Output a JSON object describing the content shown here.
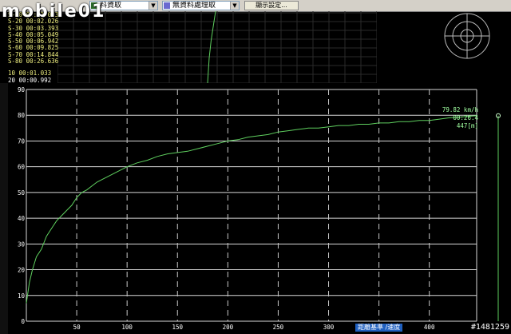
{
  "toolbar": {
    "select1_value": "料資取",
    "select2_value": "無資料處理取",
    "button_label": "顯示設定..."
  },
  "logo": "mobile01",
  "splits": [
    "S-10 00:01.033",
    "S-20 00:02.026",
    "S-30 00:03.393",
    "S-40 00:05.049",
    "S-50 00:06.942",
    "S-60 00:09.825",
    "S-70 00:14.844",
    "S-80 00:26.636"
  ],
  "splits_extra": [
    "10  00:01.033",
    "20  00:00.992"
  ],
  "readout": {
    "speed": "79.82 km/h",
    "time": "00:26.4",
    "distance": "447[m]"
  },
  "footer_label": "距離基準 /速度",
  "watermark": "#1481259",
  "colors": {
    "background": "#000000",
    "line": "#5fd05f",
    "grid": "#ffffff"
  },
  "chart_data": {
    "type": "line",
    "title": "",
    "xlabel": "",
    "ylabel": "",
    "xlim": [
      0,
      447
    ],
    "ylim": [
      0,
      90
    ],
    "xticks": [
      50,
      100,
      150,
      200,
      250,
      300,
      350,
      400
    ],
    "yticks": [
      0,
      10,
      20,
      30,
      40,
      50,
      60,
      70,
      80,
      90
    ],
    "grid": true,
    "series": [
      {
        "x": [
          0,
          3,
          6,
          10,
          15,
          20,
          25,
          30,
          35,
          40,
          45,
          50,
          55,
          60,
          70,
          80,
          90,
          100,
          110,
          120,
          130,
          140,
          150,
          160,
          170,
          180,
          190,
          200,
          210,
          220,
          230,
          240,
          250,
          260,
          270,
          280,
          290,
          300,
          310,
          320,
          330,
          340,
          350,
          360,
          370,
          380,
          390,
          400,
          410,
          420,
          430,
          440,
          447
        ],
        "y": [
          7,
          15,
          20,
          25,
          28,
          33,
          36,
          39,
          41,
          43,
          45,
          48,
          50,
          51,
          54,
          56,
          58,
          60,
          61.5,
          62.5,
          64,
          65,
          65.5,
          66,
          67,
          68,
          69,
          70,
          70.5,
          71.5,
          72,
          72.5,
          73.5,
          74,
          74.5,
          75,
          75,
          75.5,
          76,
          76,
          76.5,
          76.5,
          77,
          77,
          77.5,
          77.5,
          78,
          78,
          78.5,
          79,
          79.3,
          79.6,
          79.82
        ]
      }
    ]
  },
  "mini_chart": {
    "x": [
      0,
      0.2,
      0.45,
      1
    ],
    "y": [
      0,
      0.35,
      0.6,
      1
    ]
  }
}
